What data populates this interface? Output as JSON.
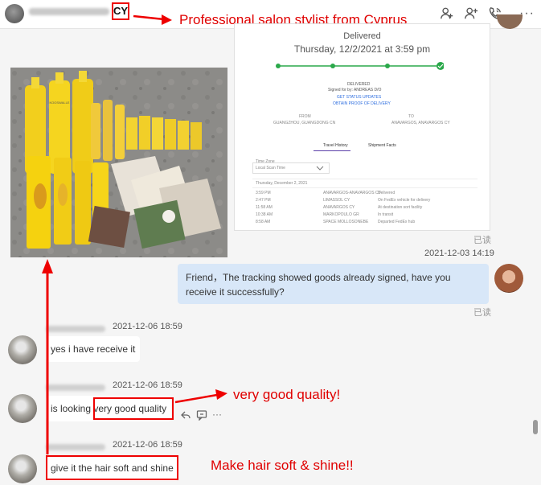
{
  "header": {
    "contact_tag": "CY",
    "icons": [
      "add-contact-icon",
      "add-member-icon",
      "call-icon",
      "more-icon"
    ],
    "more_label": "···"
  },
  "annotations": {
    "header_note": "Professional salon stylist from Cyprus",
    "quality_note": "very good quality!",
    "hair_note": "Make hair soft & shine!!"
  },
  "tracking": {
    "status": "Delivered",
    "date": "Thursday, 12/2/2021 at 3:59 pm",
    "delivered_label": "DELIVERED",
    "signed_by": "Signed for by: ANDREAS D/O",
    "get_updates": "GET STATUS UPDATES",
    "proof": "OBTAIN PROOF OF DELIVERY",
    "from_label": "FROM",
    "to_label": "TO",
    "from_value": "GUANGZHOU, GUANGDONG CN",
    "to_value": "ANAVARGOS, ANAVARGOS CY",
    "tab_travel": "Travel History",
    "tab_facts": "Shipment Facts",
    "timezone_label": "Time Zone",
    "timezone_value": "Local Scan Time",
    "day_header": "Thursday, December 2, 2021",
    "rows": [
      {
        "time": "3:59 PM",
        "place": "ANAVARGOS-ANAVARGOS CY",
        "event": "Delivered"
      },
      {
        "time": "2:47 PM",
        "place": "LIMASSOL CY",
        "event": "On FedEx vehicle for delivery"
      },
      {
        "time": "11:58 AM",
        "place": "ANAVARGOS CY",
        "event": "At destination sort facility"
      },
      {
        "time": "10:38 AM",
        "place": "MARKOPOULO GR",
        "event": "In transit"
      },
      {
        "time": "8:58 AM",
        "place": "SPACE MOLLOSONEBE",
        "event": "Departed FedEx hub"
      }
    ]
  },
  "product_photo": {
    "brand_text": "KOOSWALLE"
  },
  "messages": {
    "read_label": "已读",
    "out_timestamp": "2021-12-03 14:19",
    "out_text": "Friend，The tracking showed goods already signed, have you receive it successfully?",
    "in": [
      {
        "timestamp": "2021-12-06 18:59",
        "text": "yes i have receive it"
      },
      {
        "timestamp": "2021-12-06 18:59",
        "text_prefix": "is looking ",
        "text_highlight": "very good quality"
      },
      {
        "timestamp": "2021-12-06 18:59",
        "text": "give it the hair soft and shine"
      }
    ]
  },
  "colors": {
    "annotation_red": "#e00000",
    "outgoing_bubble": "#d8e7f8",
    "track_green": "#2aa84a"
  }
}
